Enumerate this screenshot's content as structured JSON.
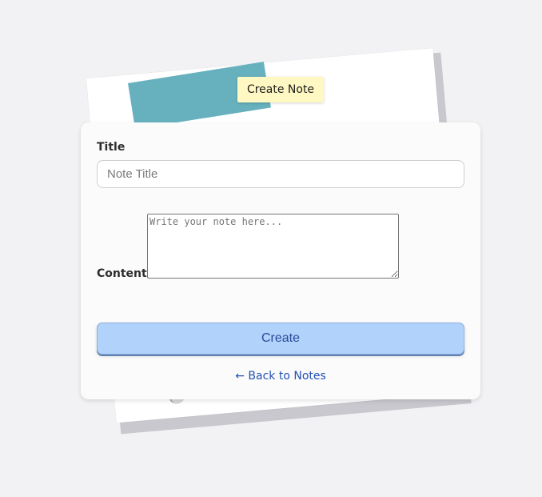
{
  "header": {
    "badge_label": "Create Note"
  },
  "form": {
    "title_label": "Title",
    "title_placeholder": "Note Title",
    "title_value": "",
    "content_label": "Content",
    "content_placeholder": "Write your note here...",
    "content_value": "",
    "create_button_label": "Create",
    "back_link_label": "← Back to Notes"
  },
  "colors": {
    "background": "#f2f2f4",
    "badge": "#fff8c2",
    "tape": "#5aaab9",
    "button": "#b0d2fb",
    "link": "#2351b4"
  }
}
